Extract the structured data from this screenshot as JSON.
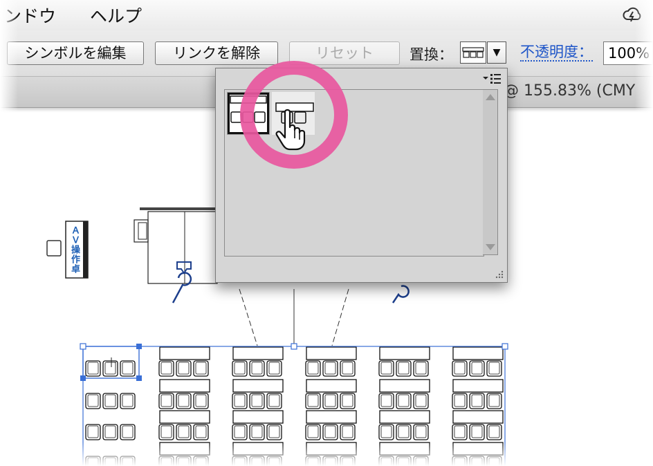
{
  "menu": {
    "window_label": "ンドウ",
    "help_label": "ヘルプ",
    "right_icon": "cloud-sync-icon"
  },
  "controlbar": {
    "edit_symbol_label": "シンボルを編集",
    "break_link_label": "リンクを解除",
    "reset_label": "リセット",
    "replace_label": "置換：",
    "replace_dropdown_icon": "chevron-down-icon",
    "opacity_label": "不透明度：",
    "opacity_value": "100%"
  },
  "document": {
    "zoom_title": "@ 155.83% (CMY"
  },
  "canvas": {
    "av_console_label": "ＡＶ操作卓"
  },
  "symbol_panel": {
    "menu_icon": "panel-menu-icon",
    "symbols": [
      {
        "name": "seat-row-symbol-3",
        "state": "selected"
      },
      {
        "name": "seat-row-symbol-2",
        "state": "hover"
      }
    ]
  },
  "highlight": {
    "color": "#e8579e"
  },
  "colors": {
    "link": "#1e55c8",
    "selection": "#3a6fd6",
    "drawing_blue": "#1d3f8c"
  }
}
